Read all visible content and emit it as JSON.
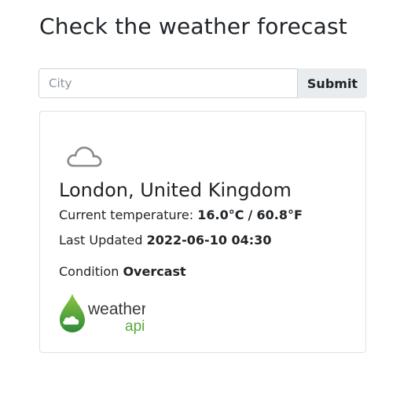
{
  "page": {
    "title": "Check the weather forecast"
  },
  "search": {
    "placeholder": "City",
    "value": "",
    "submit_label": "Submit"
  },
  "weather": {
    "icon": "overcast-cloud-icon",
    "location": "London, United Kingdom",
    "temperature_label": "Current temperature:",
    "temp_c": "16.0°C",
    "separator": "/",
    "temp_f": "60.8°F",
    "updated_label": "Last Updated",
    "updated_value": "2022-06-10 04:30",
    "condition_label": "Condition",
    "condition_value": "Overcast"
  },
  "provider_logo": {
    "icon": "weatherapi-logo",
    "text_line1": "weather",
    "text_line2": "api"
  },
  "colors": {
    "logo_green_light": "#8cc63f",
    "logo_green_dark": "#2e8b3a",
    "logo_text": "#3a3a3a",
    "cloud_gray": "#8a8a8a"
  }
}
